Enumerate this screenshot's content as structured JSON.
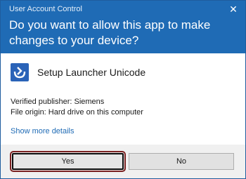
{
  "dialog": {
    "title": "User Account Control",
    "close_glyph": "✕",
    "question": "Do you want to allow this app to make changes to your device?",
    "app_name": "Setup Launcher Unicode",
    "app_icon": "setup-launcher-icon",
    "publisher": "Verified publisher: Siemens",
    "origin": "File origin: Hard drive on this computer",
    "details_link": "Show more details",
    "yes_label": "Yes",
    "no_label": "No"
  },
  "colors": {
    "header": "#1f6bb5",
    "footer": "#f0f0f0",
    "link": "#1f6bb5",
    "focus_outline": "#7a2020"
  }
}
